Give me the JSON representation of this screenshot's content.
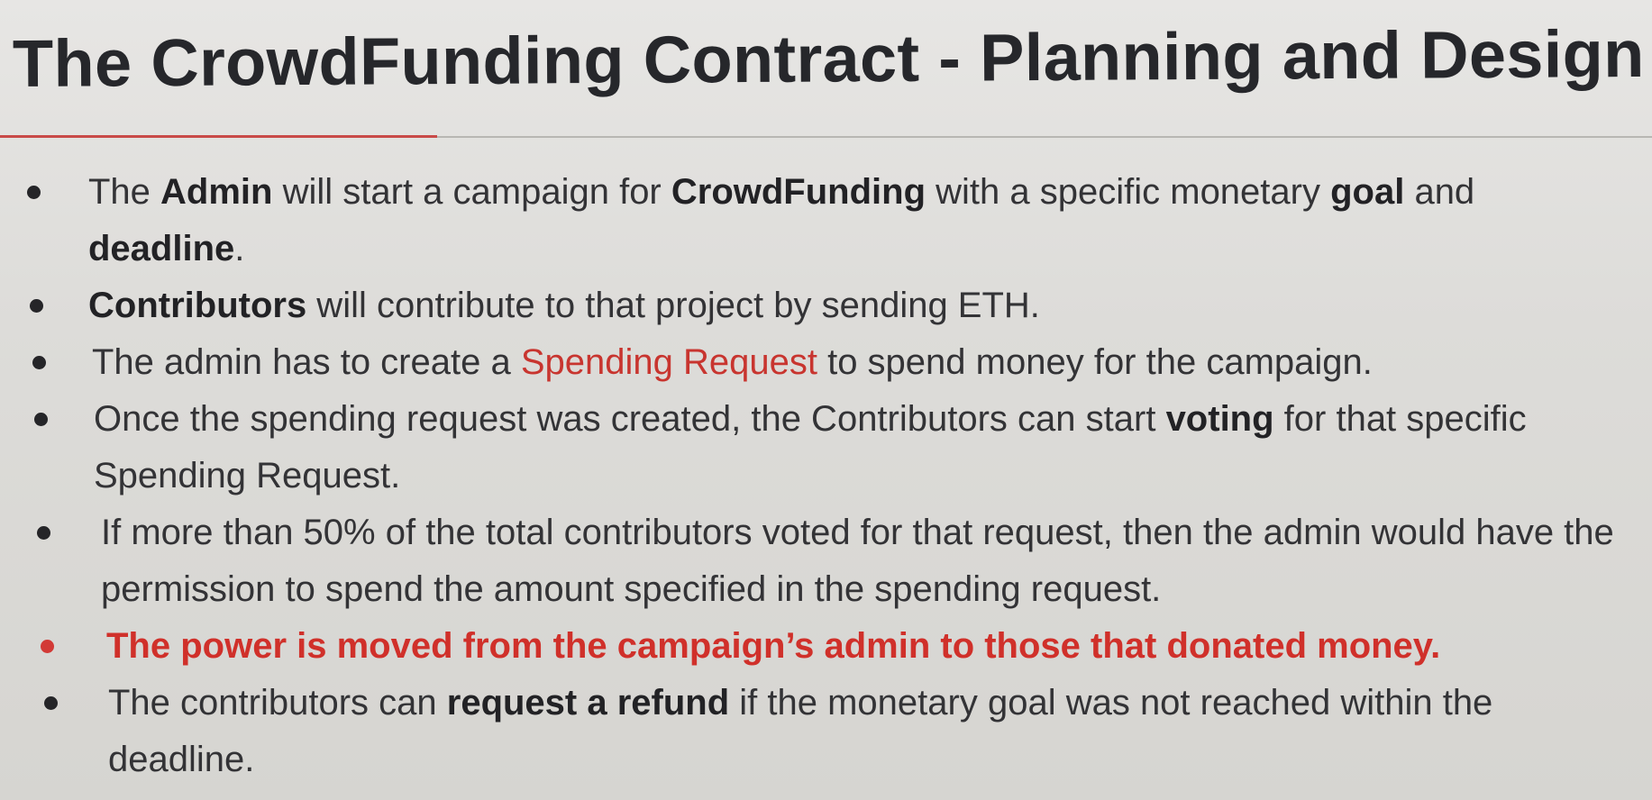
{
  "slide": {
    "title": "The CrowdFunding Contract - Planning and Design",
    "accent_color": "#c94a48",
    "bullets": [
      {
        "parts": [
          "The ",
          "Admin",
          " will start a campaign for ",
          "CrowdFunding",
          " with a specific monetary ",
          "goal",
          " and ",
          "deadline",
          "."
        ]
      },
      {
        "parts": [
          "Contributors",
          " will contribute to that project by sending ETH."
        ]
      },
      {
        "parts": [
          "The admin has to create a ",
          "Spending Request",
          " to spend money for the campaign."
        ]
      },
      {
        "parts": [
          "Once the spending request was created, the Contributors can start ",
          "voting",
          " for that specific Spending Request."
        ]
      },
      {
        "parts": [
          "If more than 50% of the total contributors voted for that request, then the admin would have the permission to spend the amount specified in the spending request."
        ]
      },
      {
        "parts": [
          "The power is moved from the campaign’s admin to those that donated money."
        ],
        "color": "#d0302a"
      },
      {
        "parts": [
          "The contributors can ",
          "request a refund",
          " if the monetary goal was not reached within the deadline."
        ]
      }
    ]
  }
}
